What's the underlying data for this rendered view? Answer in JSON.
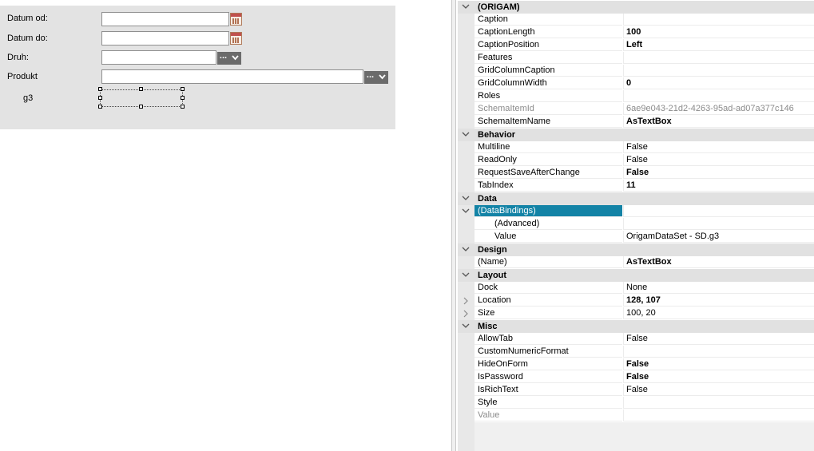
{
  "form": {
    "labels": {
      "datum_od": "Datum od:",
      "datum_do": "Datum do:",
      "druh": "Druh:",
      "produkt": "Produkt",
      "g3": "g3"
    },
    "dots_label": "..."
  },
  "property_grid": {
    "categories": {
      "origam": "(ORIGAM)",
      "behavior": "Behavior",
      "data": "Data",
      "design": "Design",
      "layout": "Layout",
      "misc": "Misc"
    },
    "origam": [
      {
        "name": "Caption",
        "value": ""
      },
      {
        "name": "CaptionLength",
        "value": "100"
      },
      {
        "name": "CaptionPosition",
        "value": "Left"
      },
      {
        "name": "Features",
        "value": ""
      },
      {
        "name": "GridColumnCaption",
        "value": ""
      },
      {
        "name": "GridColumnWidth",
        "value": "0"
      },
      {
        "name": "Roles",
        "value": ""
      },
      {
        "name": "SchemaItemId",
        "value": "6ae9e043-21d2-4263-95ad-ad07a377c146"
      },
      {
        "name": "SchemaItemName",
        "value": "AsTextBox"
      }
    ],
    "behavior": [
      {
        "name": "Multiline",
        "value": "False"
      },
      {
        "name": "ReadOnly",
        "value": "False"
      },
      {
        "name": "RequestSaveAfterChange",
        "value": "False"
      },
      {
        "name": "TabIndex",
        "value": "11"
      }
    ],
    "data": [
      {
        "name": "(DataBindings)",
        "value": ""
      },
      {
        "name": "(Advanced)",
        "value": ""
      },
      {
        "name": "Value",
        "value": "OrigamDataSet - SD.g3"
      }
    ],
    "design": [
      {
        "name": "(Name)",
        "value": "AsTextBox"
      }
    ],
    "layout": [
      {
        "name": "Dock",
        "value": "None"
      },
      {
        "name": "Location",
        "value": "128, 107"
      },
      {
        "name": "Size",
        "value": "100, 20"
      }
    ],
    "misc": [
      {
        "name": "AllowTab",
        "value": "False"
      },
      {
        "name": "CustomNumericFormat",
        "value": ""
      },
      {
        "name": "HideOnForm",
        "value": "False"
      },
      {
        "name": "IsPassword",
        "value": "False"
      },
      {
        "name": "IsRichText",
        "value": "False"
      },
      {
        "name": "Style",
        "value": ""
      },
      {
        "name": "Value",
        "value": ""
      }
    ]
  },
  "colors": {
    "selection": "#1383a6",
    "category_bg": "#e1e1e1",
    "form_bg": "#e3e3e3"
  }
}
